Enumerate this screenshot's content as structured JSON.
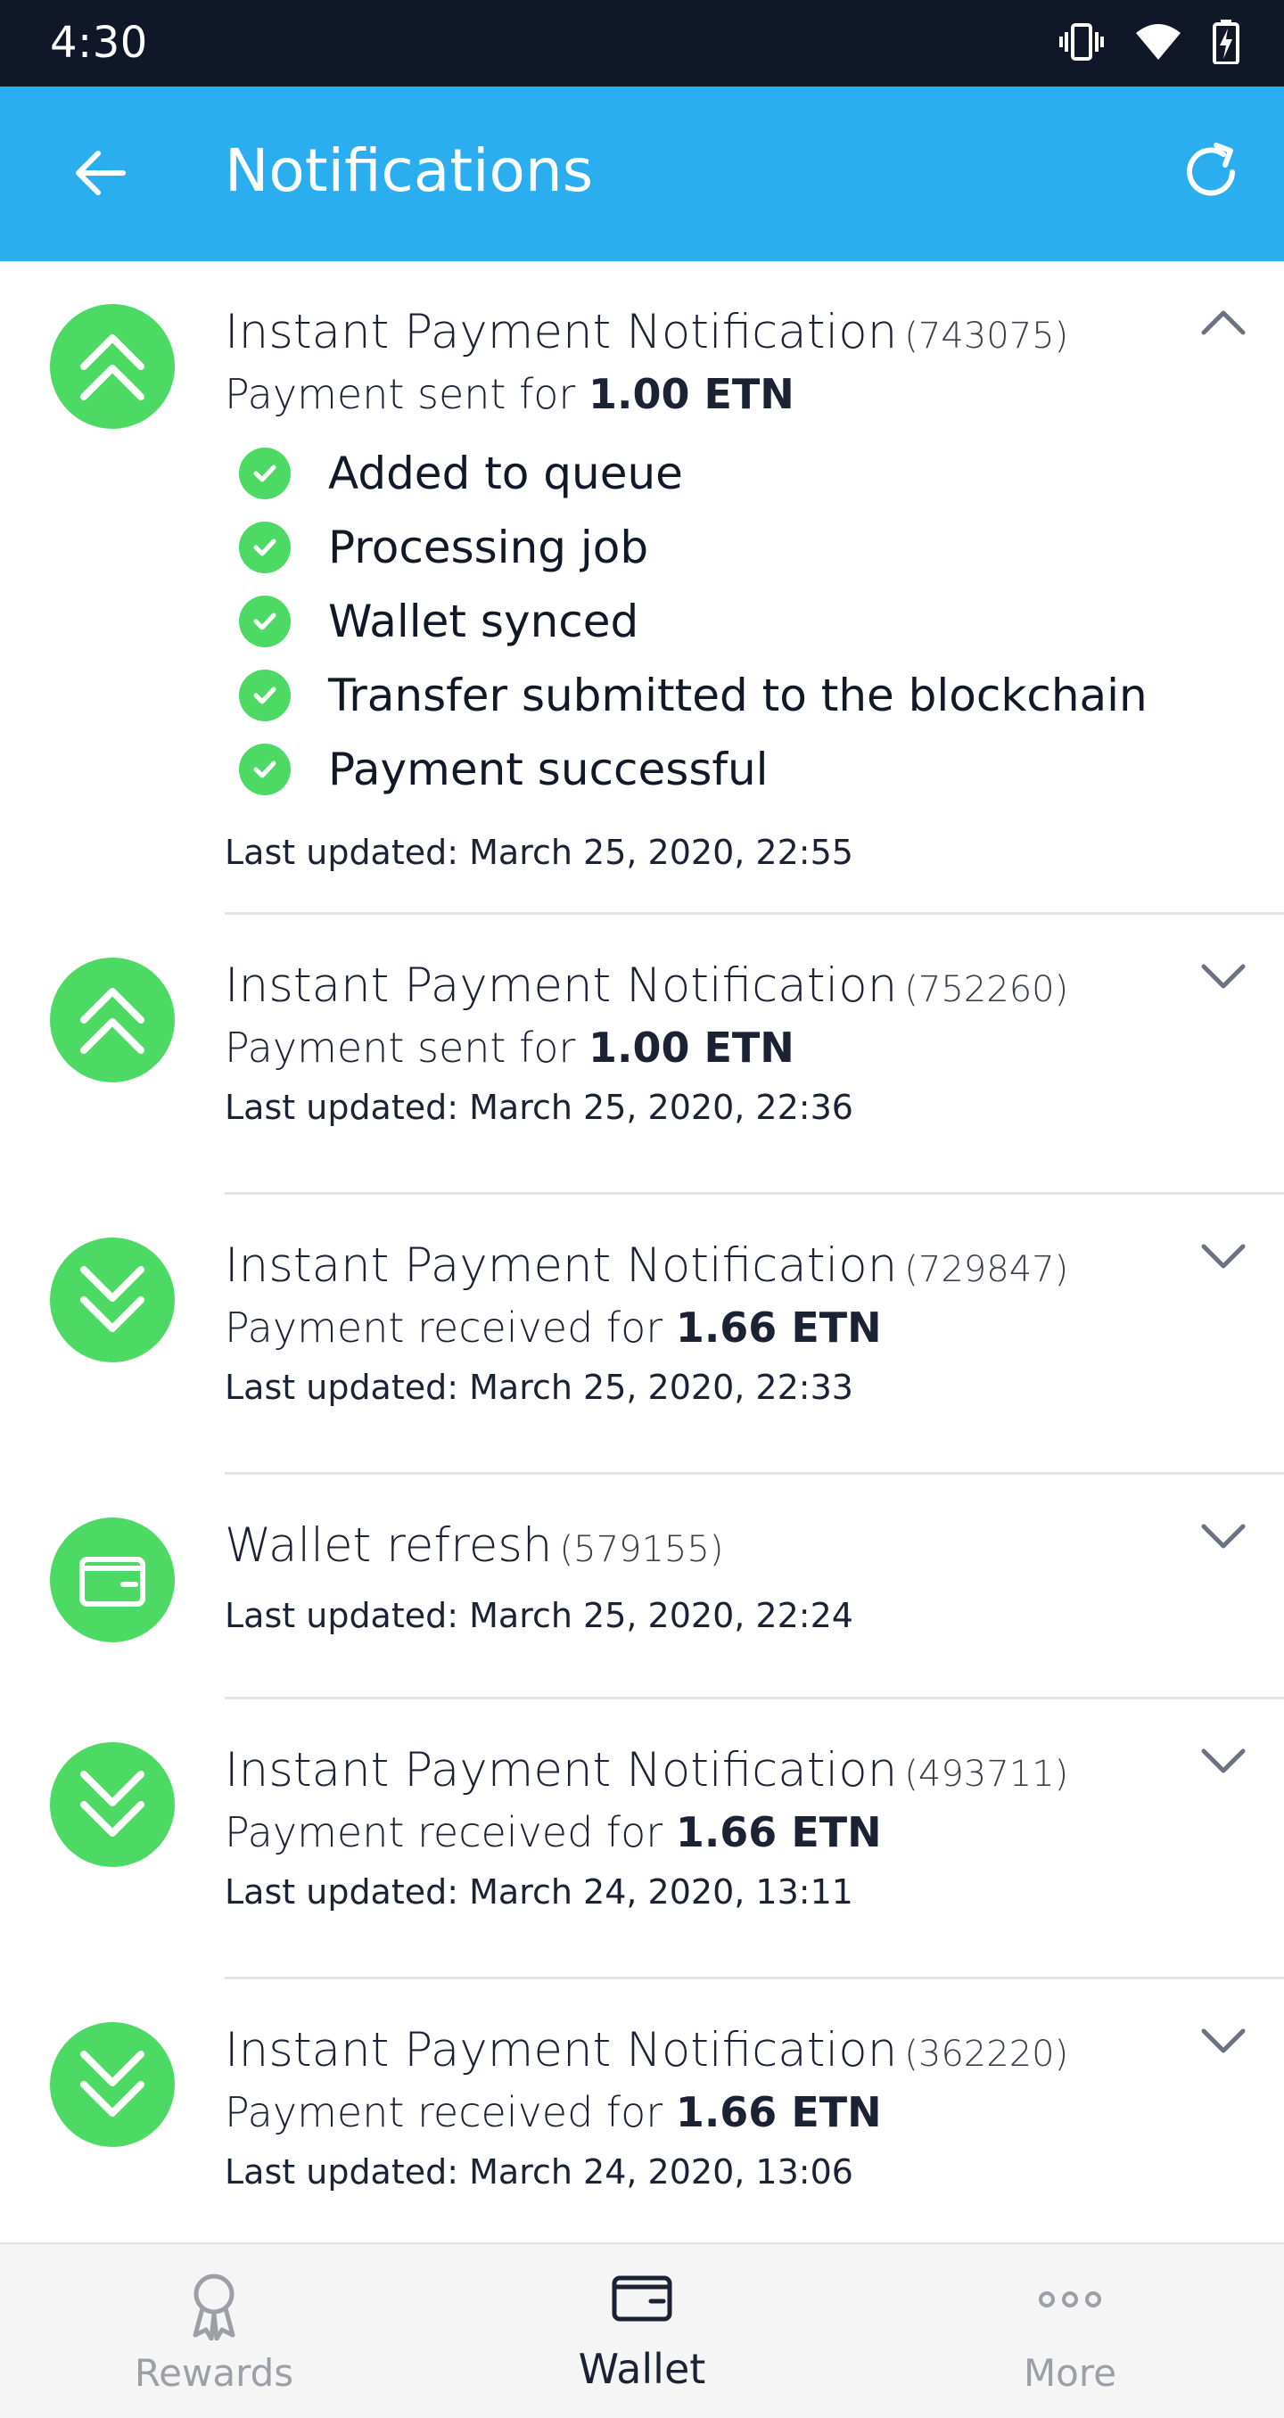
{
  "status_bar": {
    "time": "4:30"
  },
  "app_bar": {
    "title": "Notifications"
  },
  "notifications": [
    {
      "title": "Instant Payment Notification",
      "code": "(743075)",
      "subtitle_prefix": "Payment sent for ",
      "amount": "1.00 ETN",
      "icon": "arrow-up-icon",
      "expanded": true,
      "steps": [
        "Added to queue",
        "Processing job",
        "Wallet synced",
        "Transfer submitted to the blockchain",
        "Payment successful"
      ],
      "updated": "Last updated: March 25, 2020, 22:55"
    },
    {
      "title": "Instant Payment Notification",
      "code": "(752260)",
      "subtitle_prefix": "Payment sent for ",
      "amount": "1.00 ETN",
      "icon": "arrow-up-icon",
      "expanded": false,
      "updated": "Last updated: March 25, 2020, 22:36"
    },
    {
      "title": "Instant Payment Notification",
      "code": "(729847)",
      "subtitle_prefix": "Payment received for ",
      "amount": "1.66 ETN",
      "icon": "arrow-down-icon",
      "expanded": false,
      "updated": "Last updated: March 25, 2020, 22:33"
    },
    {
      "title": "Wallet refresh",
      "code": "(579155)",
      "icon": "wallet-icon",
      "expanded": false,
      "updated": "Last updated: March 25, 2020, 22:24"
    },
    {
      "title": "Instant Payment Notification",
      "code": "(493711)",
      "subtitle_prefix": "Payment received for ",
      "amount": "1.66 ETN",
      "icon": "arrow-down-icon",
      "expanded": false,
      "updated": "Last updated: March 24, 2020, 13:11"
    },
    {
      "title": "Instant Payment Notification",
      "code": "(362220)",
      "subtitle_prefix": "Payment received for ",
      "amount": "1.66 ETN",
      "icon": "arrow-down-icon",
      "expanded": false,
      "updated": "Last updated: March 24, 2020, 13:06"
    }
  ],
  "bottom_nav": {
    "rewards": "Rewards",
    "wallet": "Wallet",
    "more": "More",
    "active": "wallet"
  },
  "colors": {
    "app_bar": "#2aaef0",
    "accent_green": "#4cd964",
    "status_bar": "#0f1729"
  }
}
